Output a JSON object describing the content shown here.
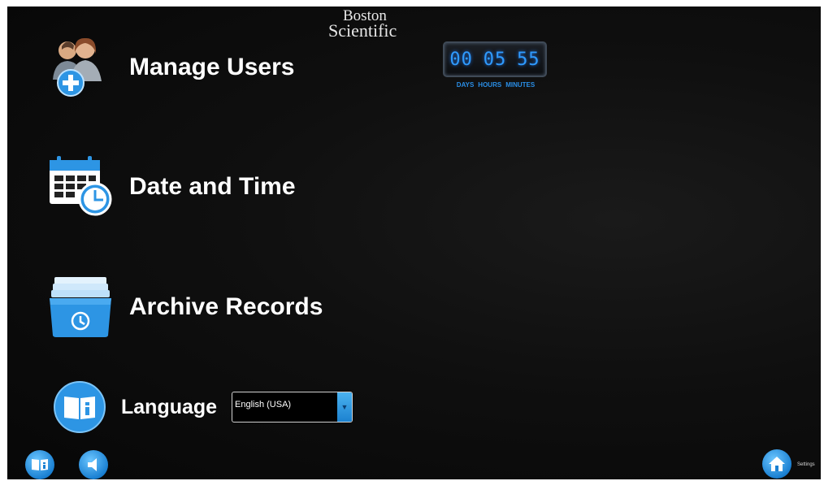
{
  "brand": {
    "line1": "Boston",
    "line2": "Scientific"
  },
  "timer": {
    "days": "00",
    "hours": "05",
    "minutes": "55",
    "labels": [
      "DAYS",
      "HOURS",
      "MINUTES"
    ]
  },
  "menu": {
    "manage_users": "Manage Users",
    "date_time": "Date and Time",
    "archive_records": "Archive Records",
    "language": "Language"
  },
  "language_select": {
    "selected": "English (USA)"
  },
  "footer": {
    "settings_label": "Settings"
  },
  "icons": {
    "users": "users-add-icon",
    "calendar": "calendar-clock-icon",
    "archive": "archive-box-icon",
    "language": "book-info-icon",
    "help": "book-info-icon",
    "sound": "speaker-icon",
    "home": "home-icon"
  },
  "colors": {
    "accent": "#1c8ee0",
    "timer_digits": "#2f9bff",
    "background": "#0b0b0b"
  }
}
